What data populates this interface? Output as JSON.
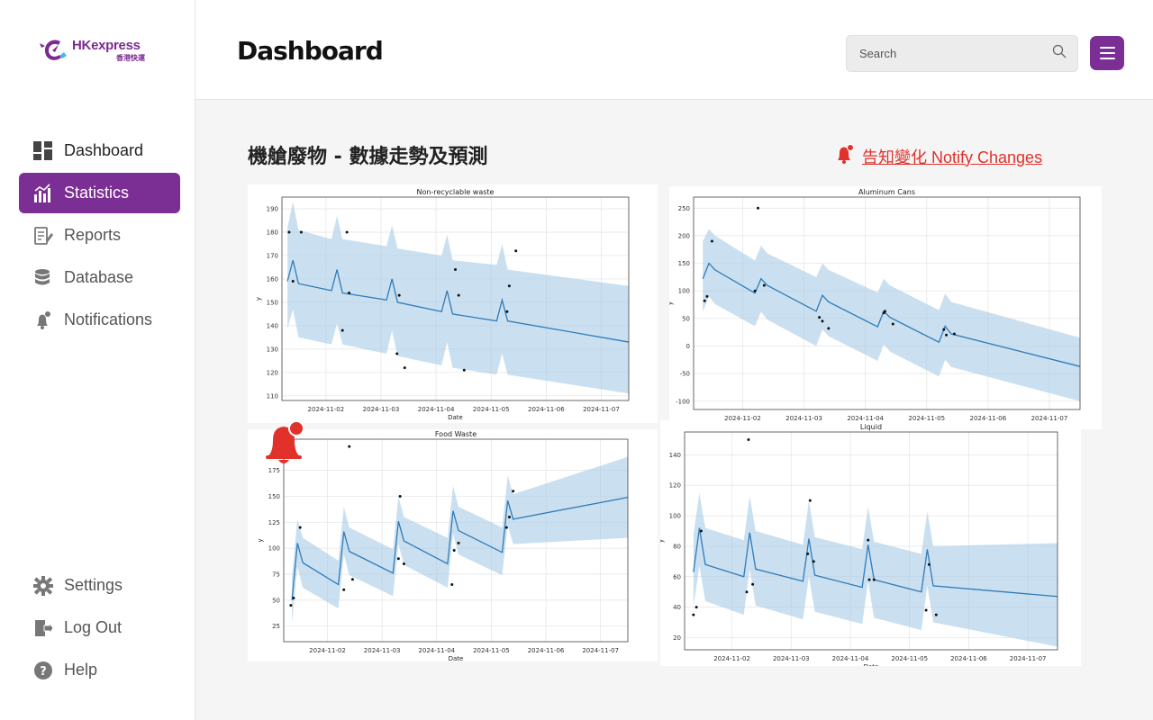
{
  "app": {
    "logo_text": "HKexpress",
    "logo_sub": "香港快運"
  },
  "header": {
    "title": "Dashboard",
    "search_placeholder": "Search"
  },
  "sidebar": {
    "items": [
      {
        "label": "Dashboard",
        "icon": "dashboard-icon"
      },
      {
        "label": "Statistics",
        "icon": "statistics-icon"
      },
      {
        "label": "Reports",
        "icon": "reports-icon"
      },
      {
        "label": "Database",
        "icon": "database-icon"
      },
      {
        "label": "Notifications",
        "icon": "notifications-icon"
      }
    ],
    "bottom": [
      {
        "label": "Settings",
        "icon": "gear-icon"
      },
      {
        "label": "Log Out",
        "icon": "logout-icon"
      },
      {
        "label": "Help",
        "icon": "help-icon"
      }
    ],
    "active": "Statistics"
  },
  "main": {
    "section_title": "機艙廢物 - 數據走勢及預測",
    "notify_label": "告知變化 Notify Changes",
    "accent": "#7b2f95",
    "alert_color": "#e0312b"
  },
  "chart_data": [
    {
      "type": "line",
      "title": "Non-recyclable waste",
      "xlabel": "Date",
      "ylabel": "y",
      "x_ticks": [
        "2024-11-02",
        "2024-11-03",
        "2024-11-04",
        "2024-11-05",
        "2024-11-06",
        "2024-11-07"
      ],
      "x_range": [
        1.2,
        7.5
      ],
      "ylim": [
        108,
        195
      ],
      "y_ticks": [
        110,
        120,
        130,
        140,
        150,
        160,
        170,
        180,
        190
      ],
      "grid": true,
      "forecast": [
        [
          1.3,
          159
        ],
        [
          1.4,
          168
        ],
        [
          1.5,
          158
        ],
        [
          2.1,
          155
        ],
        [
          2.2,
          164
        ],
        [
          2.3,
          154
        ],
        [
          3.1,
          151
        ],
        [
          3.2,
          160
        ],
        [
          3.3,
          150
        ],
        [
          4.1,
          146
        ],
        [
          4.2,
          155
        ],
        [
          4.3,
          145
        ],
        [
          5.1,
          142
        ],
        [
          5.2,
          151
        ],
        [
          5.3,
          142
        ],
        [
          7.5,
          133
        ]
      ],
      "upper": [
        [
          1.3,
          182
        ],
        [
          1.4,
          193
        ],
        [
          1.5,
          181
        ],
        [
          2.1,
          177
        ],
        [
          2.2,
          187
        ],
        [
          2.3,
          177
        ],
        [
          3.1,
          174
        ],
        [
          3.2,
          183
        ],
        [
          3.3,
          173
        ],
        [
          4.1,
          170
        ],
        [
          4.2,
          179
        ],
        [
          4.3,
          168
        ],
        [
          5.1,
          166
        ],
        [
          5.2,
          175
        ],
        [
          5.3,
          164
        ],
        [
          7.5,
          157
        ]
      ],
      "lower": [
        [
          1.3,
          139
        ],
        [
          1.4,
          147
        ],
        [
          1.5,
          135
        ],
        [
          2.1,
          132
        ],
        [
          2.2,
          141
        ],
        [
          2.3,
          132
        ],
        [
          3.1,
          128
        ],
        [
          3.2,
          138
        ],
        [
          3.3,
          127
        ],
        [
          4.1,
          123
        ],
        [
          4.2,
          133
        ],
        [
          4.3,
          122
        ],
        [
          5.1,
          119
        ],
        [
          5.2,
          128
        ],
        [
          5.3,
          119
        ],
        [
          7.5,
          111
        ]
      ],
      "points": [
        [
          1.33,
          180
        ],
        [
          1.4,
          159
        ],
        [
          1.55,
          180
        ],
        [
          2.3,
          138
        ],
        [
          2.38,
          180
        ],
        [
          2.42,
          154
        ],
        [
          3.29,
          128
        ],
        [
          3.33,
          153
        ],
        [
          3.43,
          122
        ],
        [
          4.35,
          164
        ],
        [
          4.41,
          153
        ],
        [
          4.51,
          121
        ],
        [
          5.29,
          146
        ],
        [
          5.33,
          157
        ],
        [
          5.45,
          172
        ]
      ]
    },
    {
      "type": "line",
      "title": "Aluminum Cans",
      "xlabel": "Date",
      "ylabel": "y",
      "x_ticks": [
        "2024-11-02",
        "2024-11-03",
        "2024-11-04",
        "2024-11-05",
        "2024-11-06",
        "2024-11-07"
      ],
      "x_range": [
        1.2,
        7.5
      ],
      "ylim": [
        -115,
        270
      ],
      "y_ticks": [
        -100,
        -50,
        0,
        50,
        100,
        150,
        200,
        250
      ],
      "grid": true,
      "forecast": [
        [
          1.35,
          122
        ],
        [
          1.45,
          150
        ],
        [
          1.55,
          138
        ],
        [
          2.2,
          96
        ],
        [
          2.3,
          122
        ],
        [
          2.4,
          110
        ],
        [
          3.2,
          63
        ],
        [
          3.3,
          92
        ],
        [
          3.4,
          80
        ],
        [
          4.2,
          35
        ],
        [
          4.3,
          63
        ],
        [
          4.4,
          52
        ],
        [
          5.2,
          7
        ],
        [
          5.3,
          36
        ],
        [
          5.4,
          22
        ],
        [
          7.5,
          -37
        ]
      ],
      "upper": [
        [
          1.35,
          190
        ],
        [
          1.45,
          212
        ],
        [
          1.55,
          200
        ],
        [
          2.2,
          155
        ],
        [
          2.3,
          182
        ],
        [
          2.4,
          168
        ],
        [
          3.2,
          125
        ],
        [
          3.3,
          150
        ],
        [
          3.4,
          138
        ],
        [
          4.2,
          97
        ],
        [
          4.3,
          122
        ],
        [
          4.4,
          110
        ],
        [
          5.2,
          65
        ],
        [
          5.3,
          95
        ],
        [
          5.4,
          80
        ],
        [
          7.5,
          15
        ]
      ],
      "lower": [
        [
          1.35,
          62
        ],
        [
          1.45,
          90
        ],
        [
          1.55,
          76
        ],
        [
          2.2,
          36
        ],
        [
          2.3,
          62
        ],
        [
          2.4,
          48
        ],
        [
          3.2,
          0
        ],
        [
          3.3,
          30
        ],
        [
          3.4,
          18
        ],
        [
          4.2,
          -27
        ],
        [
          4.3,
          3
        ],
        [
          4.4,
          -10
        ],
        [
          5.2,
          -55
        ],
        [
          5.3,
          -25
        ],
        [
          5.4,
          -38
        ],
        [
          7.5,
          -100
        ]
      ],
      "points": [
        [
          1.38,
          82
        ],
        [
          1.42,
          90
        ],
        [
          1.5,
          190
        ],
        [
          2.2,
          100
        ],
        [
          2.25,
          250
        ],
        [
          2.35,
          110
        ],
        [
          3.25,
          52
        ],
        [
          3.3,
          45
        ],
        [
          3.4,
          32
        ],
        [
          4.3,
          60
        ],
        [
          4.32,
          63
        ],
        [
          4.45,
          40
        ],
        [
          5.28,
          30
        ],
        [
          5.32,
          20
        ],
        [
          5.45,
          22
        ]
      ]
    },
    {
      "type": "line",
      "title": "Food Waste",
      "xlabel": "Date",
      "ylabel": "y",
      "x_ticks": [
        "2024-11-02",
        "2024-11-03",
        "2024-11-04",
        "2024-11-05",
        "2024-11-06",
        "2024-11-07"
      ],
      "x_range": [
        1.2,
        7.5
      ],
      "ylim": [
        10,
        205
      ],
      "y_ticks": [
        25,
        50,
        75,
        100,
        125,
        150,
        175
      ],
      "grid": true,
      "forecast": [
        [
          1.35,
          50
        ],
        [
          1.45,
          105
        ],
        [
          1.55,
          86
        ],
        [
          2.2,
          65
        ],
        [
          2.3,
          116
        ],
        [
          2.4,
          97
        ],
        [
          3.2,
          76
        ],
        [
          3.3,
          126
        ],
        [
          3.4,
          107
        ],
        [
          4.2,
          85
        ],
        [
          4.3,
          136
        ],
        [
          4.4,
          117
        ],
        [
          5.2,
          96
        ],
        [
          5.3,
          146
        ],
        [
          5.4,
          128
        ],
        [
          7.5,
          149
        ]
      ],
      "upper": [
        [
          1.35,
          72
        ],
        [
          1.45,
          128
        ],
        [
          1.55,
          110
        ],
        [
          2.2,
          88
        ],
        [
          2.3,
          140
        ],
        [
          2.4,
          120
        ],
        [
          3.2,
          99
        ],
        [
          3.3,
          150
        ],
        [
          3.4,
          130
        ],
        [
          4.2,
          110
        ],
        [
          4.3,
          160
        ],
        [
          4.4,
          140
        ],
        [
          5.2,
          120
        ],
        [
          5.3,
          170
        ],
        [
          5.4,
          152
        ],
        [
          7.5,
          188
        ]
      ],
      "lower": [
        [
          1.35,
          28
        ],
        [
          1.45,
          82
        ],
        [
          1.55,
          62
        ],
        [
          2.2,
          42
        ],
        [
          2.3,
          94
        ],
        [
          2.4,
          74
        ],
        [
          3.2,
          54
        ],
        [
          3.3,
          104
        ],
        [
          3.4,
          84
        ],
        [
          4.2,
          62
        ],
        [
          4.3,
          114
        ],
        [
          4.4,
          94
        ],
        [
          5.2,
          74
        ],
        [
          5.3,
          122
        ],
        [
          5.4,
          104
        ],
        [
          7.5,
          110
        ]
      ],
      "points": [
        [
          1.33,
          45
        ],
        [
          1.38,
          52
        ],
        [
          1.5,
          120
        ],
        [
          2.3,
          60
        ],
        [
          2.4,
          198
        ],
        [
          2.46,
          70
        ],
        [
          3.3,
          90
        ],
        [
          3.33,
          150
        ],
        [
          3.4,
          85
        ],
        [
          4.28,
          65
        ],
        [
          4.32,
          98
        ],
        [
          4.4,
          105
        ],
        [
          5.28,
          120
        ],
        [
          5.33,
          130
        ],
        [
          5.4,
          155
        ]
      ]
    },
    {
      "type": "line",
      "title": "Liquid",
      "xlabel": "Date",
      "ylabel": "y",
      "x_ticks": [
        "2024-11-02",
        "2024-11-03",
        "2024-11-04",
        "2024-11-05",
        "2024-11-06",
        "2024-11-07"
      ],
      "x_range": [
        1.2,
        7.5
      ],
      "ylim": [
        12,
        155
      ],
      "y_ticks": [
        20,
        40,
        60,
        80,
        100,
        120,
        140
      ],
      "grid": true,
      "forecast": [
        [
          1.35,
          63
        ],
        [
          1.45,
          92
        ],
        [
          1.55,
          68
        ],
        [
          2.2,
          60
        ],
        [
          2.3,
          89
        ],
        [
          2.4,
          65
        ],
        [
          3.2,
          57
        ],
        [
          3.3,
          85
        ],
        [
          3.4,
          61
        ],
        [
          4.2,
          53
        ],
        [
          4.3,
          81
        ],
        [
          4.4,
          58
        ],
        [
          5.2,
          50
        ],
        [
          5.3,
          78
        ],
        [
          5.4,
          54
        ],
        [
          7.5,
          47
        ]
      ],
      "upper": [
        [
          1.35,
          88
        ],
        [
          1.45,
          115
        ],
        [
          1.55,
          92
        ],
        [
          2.2,
          84
        ],
        [
          2.3,
          113
        ],
        [
          2.4,
          90
        ],
        [
          3.2,
          81
        ],
        [
          3.3,
          110
        ],
        [
          3.4,
          86
        ],
        [
          4.2,
          78
        ],
        [
          4.3,
          106
        ],
        [
          4.4,
          83
        ],
        [
          5.2,
          75
        ],
        [
          5.3,
          103
        ],
        [
          5.4,
          80
        ],
        [
          7.5,
          82
        ]
      ],
      "lower": [
        [
          1.35,
          40
        ],
        [
          1.45,
          67
        ],
        [
          1.55,
          44
        ],
        [
          2.2,
          35
        ],
        [
          2.3,
          65
        ],
        [
          2.4,
          41
        ],
        [
          3.2,
          32
        ],
        [
          3.3,
          60
        ],
        [
          3.4,
          37
        ],
        [
          4.2,
          29
        ],
        [
          4.3,
          57
        ],
        [
          4.4,
          33
        ],
        [
          5.2,
          25
        ],
        [
          5.3,
          54
        ],
        [
          5.4,
          30
        ],
        [
          7.5,
          14
        ]
      ],
      "points": [
        [
          1.35,
          35
        ],
        [
          1.4,
          40
        ],
        [
          1.48,
          90
        ],
        [
          2.25,
          50
        ],
        [
          2.28,
          150
        ],
        [
          2.35,
          55
        ],
        [
          3.28,
          75
        ],
        [
          3.32,
          110
        ],
        [
          3.38,
          70
        ],
        [
          4.3,
          84
        ],
        [
          4.32,
          58
        ],
        [
          4.4,
          58
        ],
        [
          5.28,
          38
        ],
        [
          5.33,
          68
        ],
        [
          5.45,
          35
        ]
      ]
    }
  ]
}
